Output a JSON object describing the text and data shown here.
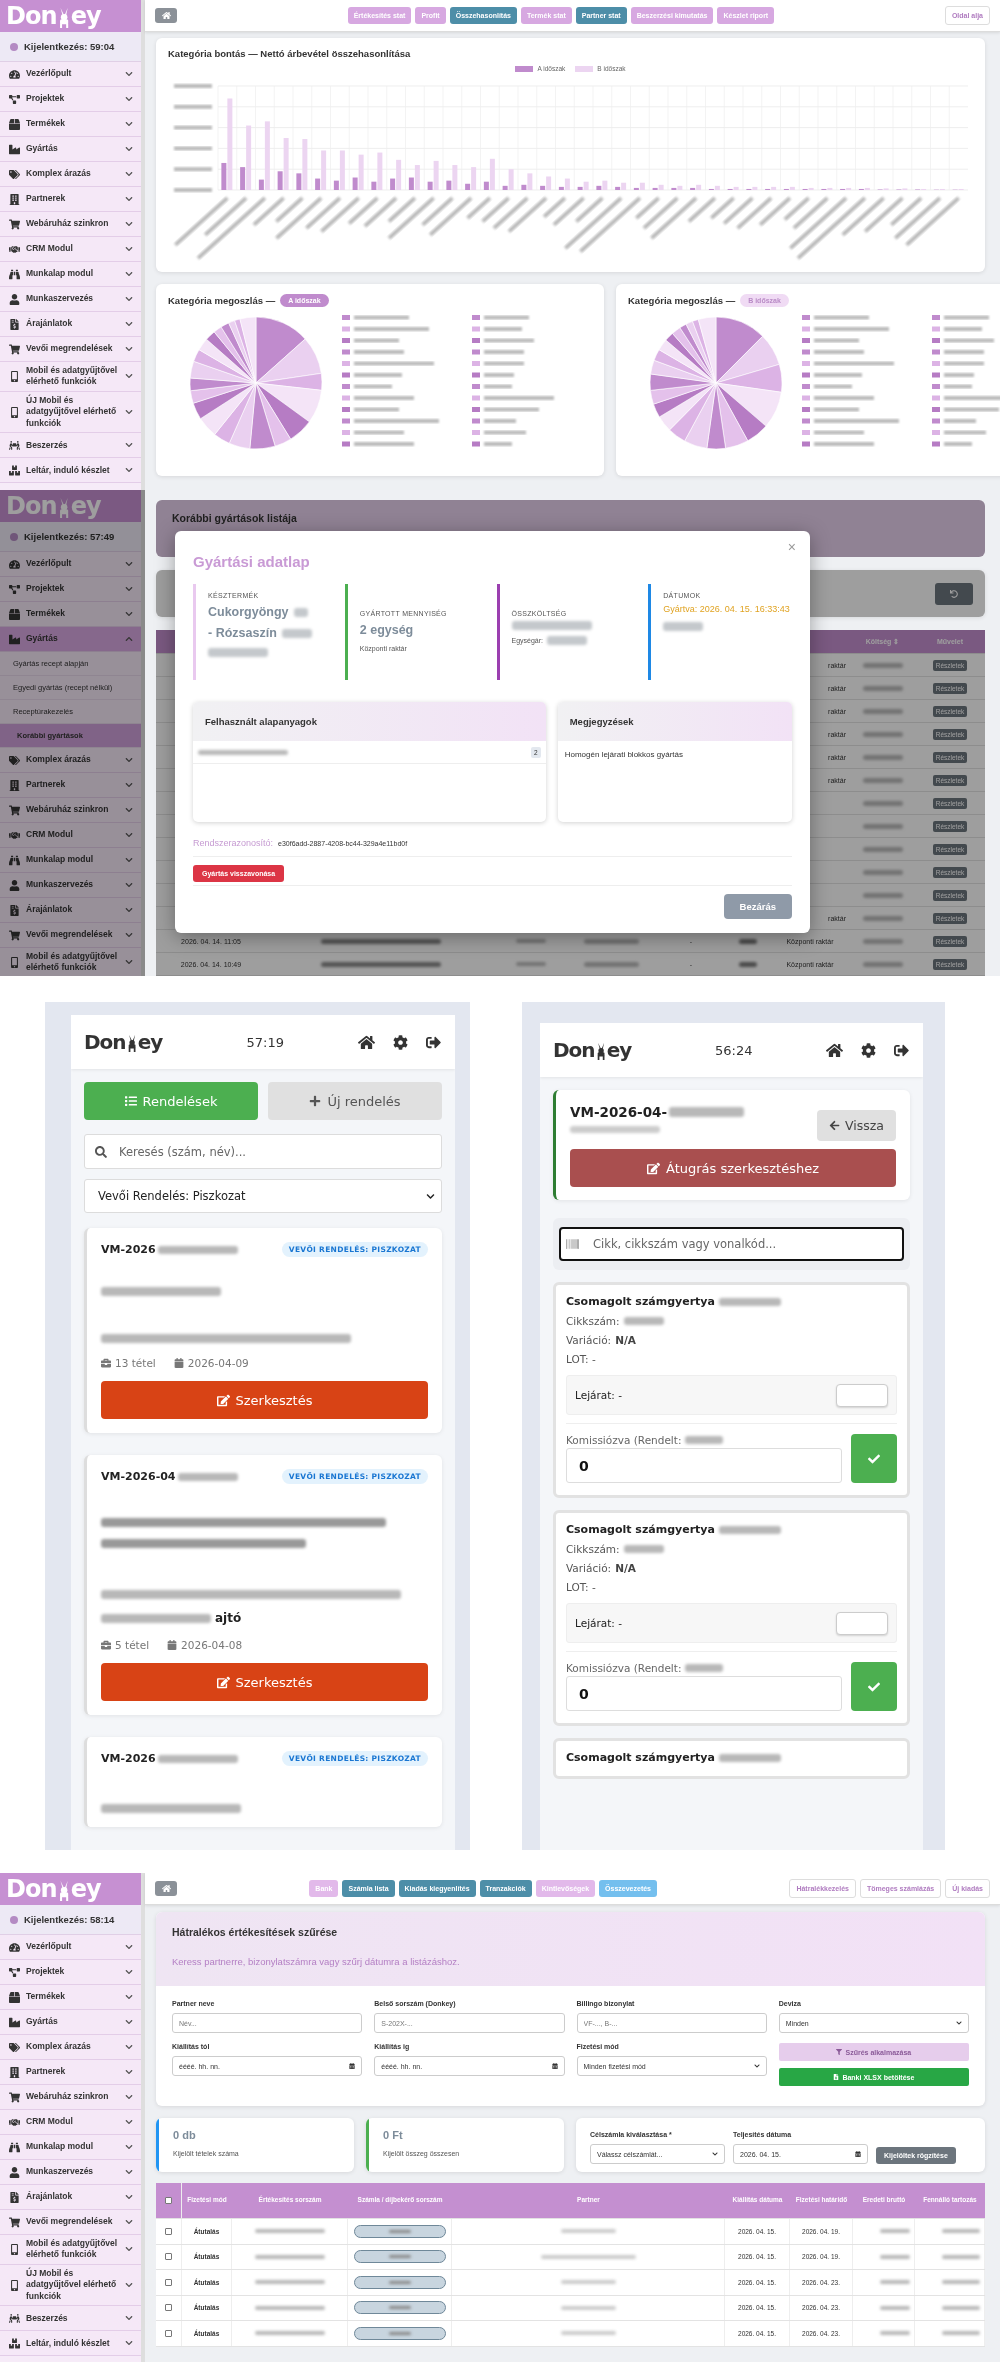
{
  "comparison_screen": {
    "sidebar": {
      "logo": {
        "left": "Don",
        "right": "ey"
      },
      "logout_timer": "Kijelentkezés: 59:04",
      "items": [
        {
          "label": "Vezérlőpult",
          "expanded": false
        },
        {
          "label": "Projektek",
          "expanded": false
        },
        {
          "label": "Termékek",
          "expanded": false
        },
        {
          "label": "Gyártás",
          "expanded": false
        },
        {
          "label": "Komplex árazás",
          "expanded": false
        },
        {
          "label": "Partnerek",
          "expanded": false
        },
        {
          "label": "Webáruház szinkron",
          "expanded": false
        },
        {
          "label": "CRM Modul",
          "expanded": false
        },
        {
          "label": "Munkalap modul",
          "expanded": false
        },
        {
          "label": "Munkaszervezés",
          "expanded": false
        },
        {
          "label": "Árajánlatok",
          "expanded": false
        },
        {
          "label": "Vevői megrendelések",
          "expanded": false
        },
        {
          "label": "Mobil és adatgyűjtővel elérhető funkciók",
          "expanded": false
        },
        {
          "label": "ÚJ Mobil és adatgyűjtővel elérhető funkciók",
          "expanded": false
        },
        {
          "label": "Beszerzés",
          "expanded": false
        },
        {
          "label": "Leltár, induló készlet",
          "expanded": false
        }
      ]
    },
    "toolbar": {
      "tabs": [
        {
          "label": "Értékesítés stat",
          "color": "#d7a8e1"
        },
        {
          "label": "Profit",
          "color": "#d7a8e1"
        },
        {
          "label": "Összehasonlítás",
          "color": "#4d8ea8"
        },
        {
          "label": "Termék stat",
          "color": "#d7a8e1"
        },
        {
          "label": "Partner stat",
          "color": "#4d8ea8"
        },
        {
          "label": "Beszerzési kimutatás",
          "color": "#d7a8e1"
        },
        {
          "label": "Készlet riport",
          "color": "#d7a8e1"
        }
      ],
      "actions": [
        "Oldal alja"
      ]
    },
    "bar_chart": {
      "title": "Kategória bontás — Nettó árbevétel összehasonlítása",
      "legend": [
        {
          "label": "A időszak",
          "color": "#c08bcd"
        },
        {
          "label": "B időszak",
          "color": "#ecd5f1"
        }
      ]
    },
    "pie_charts": [
      {
        "title": "Kategória megoszlás —",
        "badge": "A időszak",
        "kind": "strong"
      },
      {
        "title": "Kategória megoszlás —",
        "badge": "B időszak",
        "kind": "light"
      }
    ]
  },
  "production_screen": {
    "sidebar": {
      "logo": {
        "left": "Don",
        "right": "ey"
      },
      "logout_timer": "Kijelentkezés: 57:49",
      "items": [
        {
          "label": "Vezérlőpult",
          "expanded": false
        },
        {
          "label": "Projektek",
          "expanded": false
        },
        {
          "label": "Termékek",
          "expanded": false
        },
        {
          "label": "Gyártás",
          "expanded": true,
          "children": [
            {
              "label": "Gyártás recept alapján",
              "selected": false
            },
            {
              "label": "Egyedi gyártás (recept nélkül)",
              "selected": false
            },
            {
              "label": "Receptúrakezelés",
              "selected": false
            },
            {
              "label": "Korábbi gyártások",
              "selected": true
            }
          ]
        },
        {
          "label": "Komplex árazás",
          "expanded": false
        },
        {
          "label": "Partnerek",
          "expanded": false
        },
        {
          "label": "Webáruház szinkron",
          "expanded": false
        },
        {
          "label": "CRM Modul",
          "expanded": false
        },
        {
          "label": "Munkalap modul",
          "expanded": false
        },
        {
          "label": "Munkaszervezés",
          "expanded": false
        },
        {
          "label": "Árajánlatok",
          "expanded": false
        },
        {
          "label": "Vevői megrendelések",
          "expanded": false
        },
        {
          "label": "Mobil és adatgyűjtővel elérhető funkciók",
          "expanded": false
        }
      ]
    },
    "page": {
      "title": "Korábbi gyártások listája",
      "table": {
        "columns": [
          "Költség ⇕",
          "Művelet"
        ],
        "rows": [
          {
            "kind": "covered",
            "warehouse": "raktár",
            "action": "Részletek"
          },
          {
            "kind": "covered",
            "warehouse": "raktár",
            "action": "Részletek"
          },
          {
            "kind": "covered",
            "warehouse": "raktár",
            "action": "Részletek"
          },
          {
            "kind": "covered",
            "warehouse": "raktár",
            "action": "Részletek"
          },
          {
            "kind": "covered",
            "warehouse": "raktár",
            "action": "Részletek"
          },
          {
            "kind": "covered",
            "warehouse": "raktár",
            "action": "Részletek"
          },
          {
            "kind": "covered",
            "action": "Részletek"
          },
          {
            "kind": "covered",
            "action": "Részletek"
          },
          {
            "kind": "covered",
            "action": "Részletek"
          },
          {
            "kind": "covered",
            "action": "Részletek"
          },
          {
            "kind": "covered",
            "action": "Részletek"
          },
          {
            "kind": "covered",
            "warehouse": "raktár",
            "action": "Részletek"
          },
          {
            "kind": "full",
            "date": "2026. 04. 14. 11:05",
            "dash": "-",
            "warehouse": "Központi raktár",
            "action": "Részletek"
          },
          {
            "kind": "full",
            "date": "2026. 04. 14. 10:49",
            "dash": "-",
            "warehouse": "Központi raktár",
            "action": "Részletek"
          }
        ]
      }
    },
    "modal": {
      "title": "Gyártási adatlap",
      "close": "×",
      "stats": [
        {
          "label": "KÉSZTERMÉK",
          "color": "#e9c9ef",
          "kind": "product",
          "value": [
            {
              "kind": "text",
              "text": "Cukorgyöngy"
            },
            {
              "kind": "blur"
            },
            {
              "kind": "text",
              "text": "- Rózsaszín"
            },
            {
              "kind": "blur"
            }
          ],
          "sub": [
            {
              "kind": "blur"
            }
          ]
        },
        {
          "label": "GYÁRTOTT MENNYISÉG",
          "color": "#4caf50",
          "kind": "quantity",
          "value": [
            {
              "kind": "text",
              "text": "2 egység"
            }
          ],
          "sub": [
            {
              "kind": "text",
              "text": "Központi raktár"
            }
          ]
        },
        {
          "label": "ÖSSZKÖLTSÉG",
          "color": "#9b3fb0",
          "kind": "cost",
          "value": [
            {
              "kind": "blur"
            }
          ],
          "sub": [
            {
              "kind": "text",
              "text": "Egységár:"
            },
            {
              "kind": "blur"
            }
          ]
        },
        {
          "label": "DÁTUMOK",
          "color": "#1e88e5",
          "kind": "date",
          "value": [
            {
              "kind": "text",
              "text": "Gyártva: 2026. 04. 15. 16:33:43"
            }
          ],
          "sub": [
            {
              "kind": "blur"
            }
          ]
        }
      ],
      "materials": {
        "title": "Felhasznált alapanyagok",
        "items": [
          {
            "count": "2"
          }
        ]
      },
      "notes": {
        "title": "Megjegyzések",
        "text": "Homogén lejárati blokkos gyártás"
      },
      "system_id": {
        "label": "Rendszerazonosító:",
        "value": "e30f6add-2887-4208-bc44-329a4e11bd0f"
      },
      "revoke_button": "Gyártás visszavonása",
      "close_button": "Bezárás"
    }
  },
  "mobile_orders_screen": {
    "header": {
      "logo": {
        "left": "Don",
        "right": "ey"
      },
      "timer": "57:19"
    },
    "view_tabs": [
      {
        "label": "Rendelések",
        "selected": true
      },
      {
        "label": "Új rendelés",
        "selected": false
      }
    ],
    "search": {
      "placeholder": "Keresés (szám, név)..."
    },
    "status_filter": "Vevői Rendelés: Piszkozat",
    "orders": [
      {
        "kind": "short",
        "number": "VM-2026",
        "status": "VEVŐI RENDELÉS: PISZKOZAT",
        "items": "13 tétel",
        "date": "2026-04-09",
        "action": "Szerkesztés"
      },
      {
        "kind": "long",
        "number": "VM-2026-04",
        "status": "VEVŐI RENDELÉS: PISZKOZAT",
        "address_tail": "ajtó",
        "items": "5 tétel",
        "date": "2026-04-08",
        "action": "Szerkesztés"
      },
      {
        "kind": "cut",
        "number": "VM-2026",
        "status": "VEVŐI RENDELÉS: PISZKOZAT"
      }
    ]
  },
  "mobile_picking_screen": {
    "header": {
      "logo": {
        "left": "Don",
        "right": "ey"
      },
      "timer": "56:24"
    },
    "order": {
      "number": "VM-2026-04-",
      "back_button": "Vissza",
      "jump_button": "Átugrás szerkesztéshez"
    },
    "scan": {
      "placeholder": "Cikk, cikkszám vagy vonalkód..."
    },
    "items": [
      {
        "kind": "full",
        "name": "Csomagolt számgyertya",
        "sku_label": "Cikkszám:",
        "variation_label": "Variáció:",
        "variation": "N/A",
        "lot": "LOT: -",
        "expiry": "Lejárat: -",
        "picked_label": "Komissiózva (Rendelt:",
        "value": "0"
      },
      {
        "kind": "full",
        "name": "Csomagolt számgyertya",
        "sku_label": "Cikkszám:",
        "variation_label": "Variáció:",
        "variation": "N/A",
        "lot": "LOT: -",
        "expiry": "Lejárat: -",
        "picked_label": "Komissiózva (Rendelt:",
        "value": "0"
      },
      {
        "kind": "cut",
        "name": "Csomagolt számgyertya"
      }
    ]
  },
  "arrears_screen": {
    "sidebar": {
      "logo": {
        "left": "Don",
        "right": "ey"
      },
      "logout_timer": "Kijelentkezés: 58:14",
      "items": [
        {
          "label": "Vezérlőpult",
          "expanded": false
        },
        {
          "label": "Projektek",
          "expanded": false
        },
        {
          "label": "Termékek",
          "expanded": false
        },
        {
          "label": "Gyártás",
          "expanded": false
        },
        {
          "label": "Komplex árazás",
          "expanded": false
        },
        {
          "label": "Partnerek",
          "expanded": false
        },
        {
          "label": "Webáruház szinkron",
          "expanded": false
        },
        {
          "label": "CRM Modul",
          "expanded": false
        },
        {
          "label": "Munkalap modul",
          "expanded": false
        },
        {
          "label": "Munkaszervezés",
          "expanded": false
        },
        {
          "label": "Árajánlatok",
          "expanded": false
        },
        {
          "label": "Vevői megrendelések",
          "expanded": false
        },
        {
          "label": "Mobil és adatgyűjtővel elérhető funkciók",
          "expanded": false
        },
        {
          "label": "ÚJ Mobil és adatgyűjtővel elérhető funkciók",
          "expanded": false
        },
        {
          "label": "Beszerzés",
          "expanded": false
        },
        {
          "label": "Leltár, induló készlet",
          "expanded": false
        }
      ]
    },
    "toolbar": {
      "tabs": [
        {
          "label": "Bank",
          "color": "#e2b9ea"
        },
        {
          "label": "Számla lista",
          "color": "#4d8ea8"
        },
        {
          "label": "Kiadás kiegyenlítés",
          "color": "#4d8ea8"
        },
        {
          "label": "Tranzakciók",
          "color": "#4d8ea8"
        },
        {
          "label": "Kintlevőségek",
          "color": "#e2b9ea"
        },
        {
          "label": "Összevezetés",
          "color": "#74bfee"
        }
      ],
      "actions": [
        "Hátralékkezelés",
        "Tömeges számlázás",
        "Új kiadás"
      ]
    },
    "filter": {
      "title": "Hátralékos értékesítések szűrése",
      "subtitle": "Keress partnerre, bizonylatszámra vagy szűrj dátumra a listázáshoz.",
      "fields": [
        {
          "label": "Partner neve",
          "kind": "text",
          "placeholder": "Név..."
        },
        {
          "label": "Belső sorszám (Donkey)",
          "kind": "text",
          "placeholder": "S-202X-..."
        },
        {
          "label": "Billingo bizonylat",
          "kind": "text",
          "placeholder": "VF-..., B-..."
        },
        {
          "label": "Deviza",
          "kind": "select",
          "value": "Minden"
        },
        {
          "label": "Kiállítás tól",
          "kind": "date",
          "value": "éééé. hh. nn."
        },
        {
          "label": "Kiállítás ig",
          "kind": "date",
          "value": "éééé. hh. nn."
        },
        {
          "label": "Fizetési mód",
          "kind": "select",
          "value": "Minden fizetési mód"
        }
      ],
      "buttons": [
        {
          "kind": "filter",
          "label": "Szűrés alkalmazása",
          "disabled": true
        },
        {
          "kind": "import",
          "label": "Banki XLSX betöltése",
          "disabled": false
        }
      ]
    },
    "summary": [
      {
        "value": "0 db",
        "caption": "Kijelölt tételek száma",
        "color": "#2196f3"
      },
      {
        "value": "0 Ft",
        "caption": "Kijelölt összeg összesen",
        "color": "#4caf50"
      }
    ],
    "booking": {
      "fields": [
        {
          "label": "Célszámla kiválasztása *",
          "kind": "select",
          "value": "Válassz célszámlát..."
        },
        {
          "label": "Teljesítés dátuma",
          "kind": "date",
          "value": "2026. 04. 15."
        }
      ],
      "button": "Kijelöltek rögzítése"
    },
    "table": {
      "select_all": false,
      "columns": [
        "Fizetési mód",
        "Értékesítés sorszám",
        "Számla / díjbekérő sorszám",
        "Partner",
        "Kiállítás dátuma",
        "Fizetési határidő",
        "Eredeti bruttó",
        "Fennálló tartozás"
      ],
      "rows": [
        {
          "checked": false,
          "method": "Átutalás",
          "issued": "2026. 04. 15.",
          "due": "2026. 04. 19."
        },
        {
          "checked": false,
          "method": "Átutalás",
          "issued": "2026. 04. 15.",
          "due": "2026. 04. 19."
        },
        {
          "checked": false,
          "method": "Átutalás",
          "issued": "2026. 04. 15.",
          "due": "2026. 04. 23."
        },
        {
          "checked": false,
          "method": "Átutalás",
          "issued": "2026. 04. 15.",
          "due": "2026. 04. 23."
        },
        {
          "checked": false,
          "method": "Átutalás",
          "issued": "2026. 04. 15.",
          "due": "2026. 04. 23."
        }
      ]
    }
  }
}
